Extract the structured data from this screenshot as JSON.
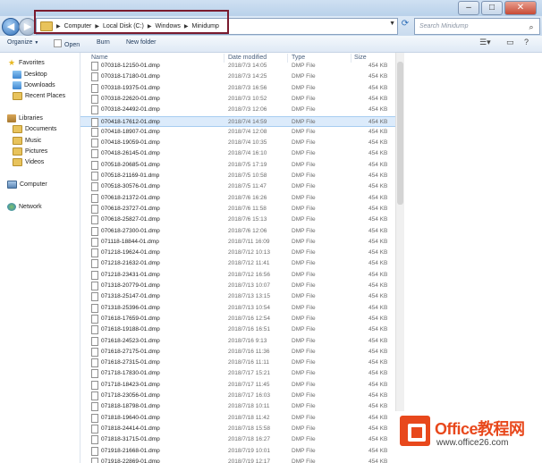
{
  "address": {
    "crumbs": [
      "Computer",
      "Local Disk (C:)",
      "Windows",
      "Minidump"
    ]
  },
  "search": {
    "placeholder": "Search Minidump"
  },
  "toolbar": {
    "organize": "Organize",
    "open": "Open",
    "burn": "Burn",
    "new_folder": "New folder"
  },
  "nav": {
    "favorites": "Favorites",
    "desktop": "Desktop",
    "downloads": "Downloads",
    "recent": "Recent Places",
    "libraries": "Libraries",
    "documents": "Documents",
    "music": "Music",
    "pictures": "Pictures",
    "videos": "Videos",
    "computer": "Computer",
    "network": "Network"
  },
  "columns": {
    "name": "Name",
    "date": "Date modified",
    "type": "Type",
    "size": "Size"
  },
  "files": [
    {
      "name": "070318-12150-01.dmp",
      "date": "2018/7/3 14:05",
      "type": "DMP File",
      "size": "454 KB"
    },
    {
      "name": "070318-17180-01.dmp",
      "date": "2018/7/3 14:25",
      "type": "DMP File",
      "size": "454 KB"
    },
    {
      "name": "070318-19375-01.dmp",
      "date": "2018/7/3 16:56",
      "type": "DMP File",
      "size": "454 KB"
    },
    {
      "name": "070318-22620-01.dmp",
      "date": "2018/7/3 10:52",
      "type": "DMP File",
      "size": "454 KB"
    },
    {
      "name": "070318-24492-01.dmp",
      "date": "2018/7/3 12:06",
      "type": "DMP File",
      "size": "454 KB"
    },
    {
      "name": "070418-17612-01.dmp",
      "date": "2018/7/4 14:59",
      "type": "DMP File",
      "size": "454 KB",
      "selected": true
    },
    {
      "name": "070418-18907-01.dmp",
      "date": "2018/7/4 12:08",
      "type": "DMP File",
      "size": "454 KB"
    },
    {
      "name": "070418-19059-01.dmp",
      "date": "2018/7/4 10:35",
      "type": "DMP File",
      "size": "454 KB"
    },
    {
      "name": "070418-26145-01.dmp",
      "date": "2018/7/4 16:10",
      "type": "DMP File",
      "size": "454 KB"
    },
    {
      "name": "070518-20685-01.dmp",
      "date": "2018/7/5 17:19",
      "type": "DMP File",
      "size": "454 KB"
    },
    {
      "name": "070518-21169-01.dmp",
      "date": "2018/7/5 10:58",
      "type": "DMP File",
      "size": "454 KB"
    },
    {
      "name": "070518-30576-01.dmp",
      "date": "2018/7/5 11:47",
      "type": "DMP File",
      "size": "454 KB"
    },
    {
      "name": "070618-21372-01.dmp",
      "date": "2018/7/6 16:26",
      "type": "DMP File",
      "size": "454 KB"
    },
    {
      "name": "070618-23727-01.dmp",
      "date": "2018/7/6 11:58",
      "type": "DMP File",
      "size": "454 KB"
    },
    {
      "name": "070618-25827-01.dmp",
      "date": "2018/7/6 15:13",
      "type": "DMP File",
      "size": "454 KB"
    },
    {
      "name": "070618-27300-01.dmp",
      "date": "2018/7/6 12:06",
      "type": "DMP File",
      "size": "454 KB"
    },
    {
      "name": "071118-18844-01.dmp",
      "date": "2018/7/11 16:09",
      "type": "DMP File",
      "size": "454 KB"
    },
    {
      "name": "071218-19624-01.dmp",
      "date": "2018/7/12 10:13",
      "type": "DMP File",
      "size": "454 KB"
    },
    {
      "name": "071218-21632-01.dmp",
      "date": "2018/7/12 11:41",
      "type": "DMP File",
      "size": "454 KB"
    },
    {
      "name": "071218-23431-01.dmp",
      "date": "2018/7/12 16:56",
      "type": "DMP File",
      "size": "454 KB"
    },
    {
      "name": "071318-20779-01.dmp",
      "date": "2018/7/13 10:07",
      "type": "DMP File",
      "size": "454 KB"
    },
    {
      "name": "071318-25147-01.dmp",
      "date": "2018/7/13 13:15",
      "type": "DMP File",
      "size": "454 KB"
    },
    {
      "name": "071318-25396-01.dmp",
      "date": "2018/7/13 10:54",
      "type": "DMP File",
      "size": "454 KB"
    },
    {
      "name": "071618-17659-01.dmp",
      "date": "2018/7/16 12:54",
      "type": "DMP File",
      "size": "454 KB"
    },
    {
      "name": "071618-19188-01.dmp",
      "date": "2018/7/16 16:51",
      "type": "DMP File",
      "size": "454 KB"
    },
    {
      "name": "071618-24523-01.dmp",
      "date": "2018/7/16 9:13",
      "type": "DMP File",
      "size": "454 KB"
    },
    {
      "name": "071618-27175-01.dmp",
      "date": "2018/7/16 11:36",
      "type": "DMP File",
      "size": "454 KB"
    },
    {
      "name": "071618-27315-01.dmp",
      "date": "2018/7/16 11:11",
      "type": "DMP File",
      "size": "454 KB"
    },
    {
      "name": "071718-17830-01.dmp",
      "date": "2018/7/17 15:21",
      "type": "DMP File",
      "size": "454 KB"
    },
    {
      "name": "071718-18423-01.dmp",
      "date": "2018/7/17 11:45",
      "type": "DMP File",
      "size": "454 KB"
    },
    {
      "name": "071718-23056-01.dmp",
      "date": "2018/7/17 16:03",
      "type": "DMP File",
      "size": "454 KB"
    },
    {
      "name": "071818-18798-01.dmp",
      "date": "2018/7/18 10:11",
      "type": "DMP File",
      "size": "454 KB"
    },
    {
      "name": "071818-19640-01.dmp",
      "date": "2018/7/18 11:42",
      "type": "DMP File",
      "size": "454 KB"
    },
    {
      "name": "071818-24414-01.dmp",
      "date": "2018/7/18 15:58",
      "type": "DMP File",
      "size": "454 KB"
    },
    {
      "name": "071818-31715-01.dmp",
      "date": "2018/7/18 16:27",
      "type": "DMP File",
      "size": "454 KB"
    },
    {
      "name": "071918-21668-01.dmp",
      "date": "2018/7/19 10:01",
      "type": "DMP File",
      "size": "454 KB"
    },
    {
      "name": "071918-22869-01.dmp",
      "date": "2018/7/19 12:17",
      "type": "DMP File",
      "size": "454 KB"
    }
  ],
  "watermark": {
    "title": "Office教程网",
    "url": "www.office26.com"
  }
}
